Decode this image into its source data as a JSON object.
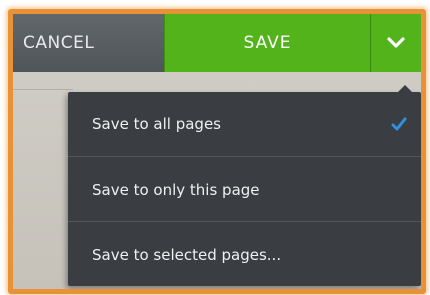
{
  "toolbar": {
    "cancel_label": "CANCEL",
    "save_label": "SAVE",
    "dropdown_icon": "chevron-down-icon"
  },
  "menu": {
    "items": [
      {
        "label": "Save to all pages",
        "selected": true
      },
      {
        "label": "Save to only this page",
        "selected": false
      },
      {
        "label": "Save to selected pages...",
        "selected": false
      }
    ]
  },
  "colors": {
    "save_green": "#52b41a",
    "cancel_gray": "#5a5f64",
    "menu_bg": "#3a3e42",
    "check_blue": "#2f8fe0",
    "highlight_orange": "#e89238"
  }
}
